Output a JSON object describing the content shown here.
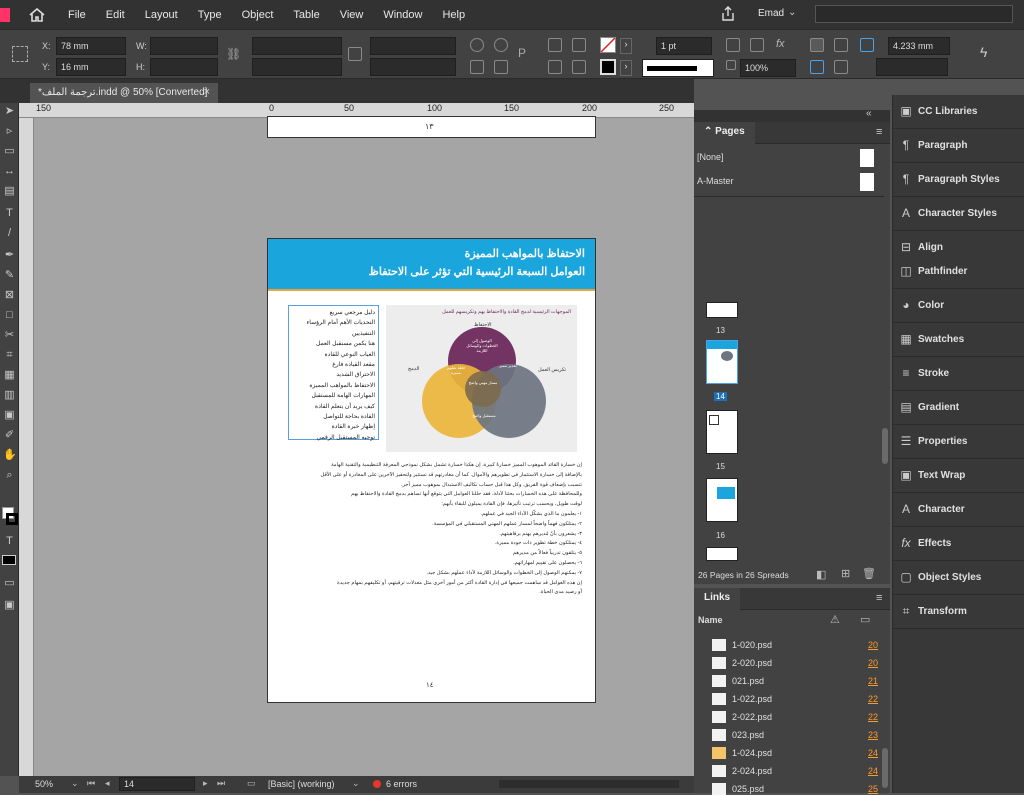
{
  "menu": {
    "items": [
      "File",
      "Edit",
      "Layout",
      "Type",
      "Object",
      "Table",
      "View",
      "Window",
      "Help"
    ],
    "user": "Emad"
  },
  "control": {
    "x_label": "X:",
    "y_label": "Y:",
    "w_label": "W:",
    "h_label": "H:",
    "x_value": "78 mm",
    "y_value": "16 mm",
    "stroke_weight": "1 pt",
    "opacity": "100%",
    "size_value": "4.233 mm"
  },
  "doc_tab": {
    "title": "*ترجمة الملف.indd @ 50% [Converted]"
  },
  "ruler": {
    "ticks": [
      "150",
      "0",
      "50",
      "100",
      "150",
      "200",
      "250"
    ]
  },
  "page_prev": {
    "number": "١٣"
  },
  "page_main": {
    "title1": "الاحتفاظ بالمواهب المميزة",
    "title2": "العوامل السبعة الرئيسية التي تؤثر على الاحتفاظ",
    "toc": [
      "دليل مرجعي سريع",
      "التحديات الأهم أمام الرؤساء التنفيذيين",
      "هنا يكمن مستقبل العمل",
      "الغياب النوعي للقادة",
      "مقعد القيادة فارغ",
      "الاحتراق الشديد",
      "الاحتفاظ بالمواهب المميزة",
      "المهارات الهامة للمستقبل",
      "كيف يريد أن يتعلم القادة",
      "القادة بحاجة للتواصل",
      "إظهار خبرة القادة",
      "توجيه المستقبل الرقمي"
    ],
    "venn_caption": "الموجهات الرئيسية لدمج القادة والاحتفاظ بهم وتكريسهم للعمل",
    "venn_labels": {
      "top": "الاحتفاظ",
      "left": "الدمج",
      "right": "تكريس العمل",
      "top_inner": "الوصول إلى الخطوات والوسائل اللازمة",
      "left_inner": "خطة تطوير مميزة",
      "right_inner": "تقدير مميز",
      "center": "مسار مهني واضح",
      "bottom": "مستقبل واضح"
    },
    "body": [
      "إن خسارة القائد الموهوب المميز خسارةً كبيرة، إن هكذا خسارة تشمل بشكل نموذجي المعرفة التنظيمية والتقنية الهامة",
      "بالإضافة إلى خسارة الاستثمار في تطويرهم والأموال. كما أن مغادرتهم قد تستثير ولتحفيز الآخرين على المغادرة أو على الأقل",
      "تتسبب بإضعاف قوة الفريق. وكل هذا قبل حساب تكاليف الاستبدال بموهوب مميز آخر.",
      "وللمحافظة على هذه الخسارات بحثنا لأدلة، فقد حللنا العوامل التي يتوقع أنها تساهم بدمج القادة والاحتفاظ بهم",
      "لوقت طويل، وبحسب ترتيب تأثيرها، فإن القادة يميلون للبقاء بأنهم:",
      "١- يعلمون ما الذي يشكّل الأداء الجيد في عملهم.",
      "٢- يمتلكون فهماً واضحاً لمسار عملهم المهني المستقبلي في المؤسسة.",
      "٣- يشعرون بأنّ مُديرهم يهتم برفاهيتهم.",
      "٤- يمتلكون خطة تطوير ذات جودة مميزة.",
      "٥- يتلقون تدريباً فعالاً من مديرهم",
      "٦- يحصلون على تقييم لمهاراتهم.",
      "٧- يمكنهم الوصول إلى الخطوات والوسائل اللازمة لأداء عملهم بشكل جيد.",
      "إن هذه العوامل قد ساهمت جميعها في إدارة القادة أكثر من أمور أخرى مثل معدلات ترقيتهم، أو تكليفهم بمهام جديدة",
      "أو رصيد مدى الحياة."
    ],
    "number": "١٤"
  },
  "status": {
    "zoom": "50%",
    "page": "14",
    "style": "[Basic] (working)",
    "errors": "6 errors"
  },
  "pages_panel": {
    "tab": "Pages",
    "none": "[None]",
    "master": "A-Master",
    "nums": [
      "13",
      "14",
      "15",
      "16"
    ],
    "footer": "26 Pages in 26 Spreads"
  },
  "links_panel": {
    "tab": "Links",
    "col_name": "Name",
    "rows": [
      {
        "name": "1-020.psd",
        "page": "20"
      },
      {
        "name": "2-020.psd",
        "page": "20"
      },
      {
        "name": "021.psd",
        "page": "21"
      },
      {
        "name": "1-022.psd",
        "page": "22"
      },
      {
        "name": "2-022.psd",
        "page": "22"
      },
      {
        "name": "023.psd",
        "page": "23"
      },
      {
        "name": "1-024.psd",
        "page": "24"
      },
      {
        "name": "2-024.psd",
        "page": "24"
      },
      {
        "name": "025.psd",
        "page": "25"
      }
    ]
  },
  "right_panels": [
    "CC Libraries",
    "Paragraph",
    "Paragraph Styles",
    "Character Styles",
    "Align",
    "Pathfinder",
    "Color",
    "Swatches",
    "Stroke",
    "Gradient",
    "Properties",
    "Text Wrap",
    "Character",
    "Effects",
    "Object Styles",
    "Transform"
  ],
  "colors": {
    "banner": "#1aa6dc",
    "accent_orange": "#f0a23a",
    "venn_purple": "#6e2a5c",
    "venn_yellow": "#ebb53a",
    "venn_gray": "#6c7480"
  }
}
